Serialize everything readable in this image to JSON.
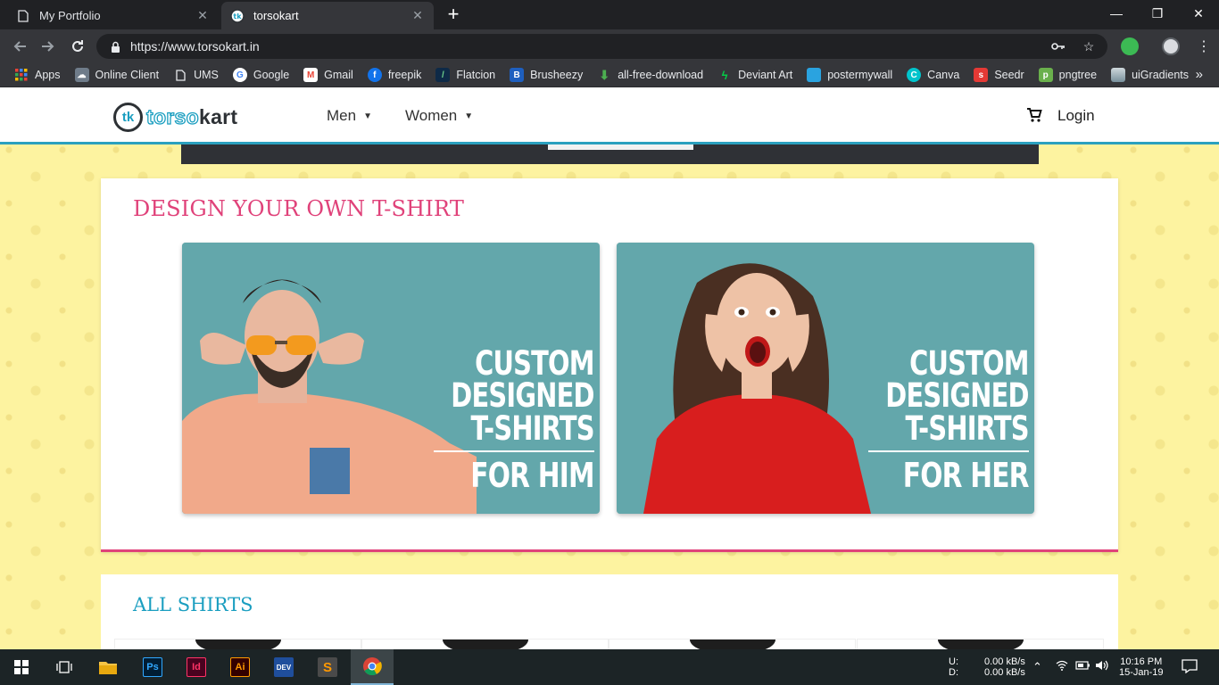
{
  "browser": {
    "tabs": [
      {
        "title": "My Portfolio",
        "active": false
      },
      {
        "title": "torsokart",
        "active": true
      }
    ],
    "new_tab": "+",
    "window_controls": {
      "minimize": "—",
      "restore": "❐",
      "close": "✕"
    },
    "url": "https://www.torsokart.in",
    "bookmarks": [
      {
        "label": "Apps",
        "icon": "apps-grid-icon",
        "color": "#ea4335"
      },
      {
        "label": "Online Client",
        "icon": "cloud-icon",
        "color": "#9aa0a6"
      },
      {
        "label": "UMS",
        "icon": "page-icon",
        "color": "#e8eaed"
      },
      {
        "label": "Google",
        "icon": "google-icon",
        "color": "#4285f4"
      },
      {
        "label": "Gmail",
        "icon": "gmail-icon",
        "color": "#ea4335"
      },
      {
        "label": "freepik",
        "icon": "freepik-icon",
        "color": "#1273eb"
      },
      {
        "label": "Flatcion",
        "icon": "flaticon-icon",
        "color": "#0e2a47"
      },
      {
        "label": "Brusheezy",
        "icon": "brusheezy-icon",
        "color": "#1e5fbf"
      },
      {
        "label": "all-free-download",
        "icon": "download-arrow-icon",
        "color": "#4caf50"
      },
      {
        "label": "Deviant Art",
        "icon": "deviantart-icon",
        "color": "#05cc47"
      },
      {
        "label": "postermywall",
        "icon": "postermywall-icon",
        "color": "#2aa3e0"
      },
      {
        "label": "Canva",
        "icon": "canva-icon",
        "color": "#00c4cc"
      },
      {
        "label": "Seedr",
        "icon": "seedr-icon",
        "color": "#e53935"
      },
      {
        "label": "pngtree",
        "icon": "pngtree-icon",
        "color": "#6ab04c"
      },
      {
        "label": "uiGradients",
        "icon": "uigradients-icon",
        "color": "#b0bec5"
      }
    ],
    "bookmarks_more": "»"
  },
  "site": {
    "nav": {
      "men": "Men",
      "women": "Women",
      "login": "Login"
    },
    "brand_color": "#1a9ec0",
    "accent_color": "#e0427a",
    "design_section": {
      "heading": "DESIGN YOUR OWN T-SHIRT",
      "promos": [
        {
          "lines": [
            "CUSTOM",
            "DESIGNED",
            "T-SHIRTS"
          ],
          "for": "FOR HIM"
        },
        {
          "lines": [
            "CUSTOM",
            "DESIGNED",
            "T-SHIRTS"
          ],
          "for": "FOR HER"
        }
      ]
    },
    "shirts_section": {
      "heading": "ALL SHIRTS"
    }
  },
  "taskbar": {
    "apps": [
      "start-icon",
      "task-view-icon",
      "file-explorer-icon",
      "photoshop-icon",
      "indesign-icon",
      "illustrator-icon",
      "dev-cpp-icon",
      "sublime-text-icon",
      "chrome-icon"
    ],
    "ps": "Ps",
    "id": "Id",
    "ai": "Ai",
    "dev": "DEV",
    "net_up_label": "U:",
    "net_down_label": "D:",
    "net_up": "0.00 kB/s",
    "net_down": "0.00 kB/s",
    "time": "10:16 PM",
    "date": "15-Jan-19"
  }
}
